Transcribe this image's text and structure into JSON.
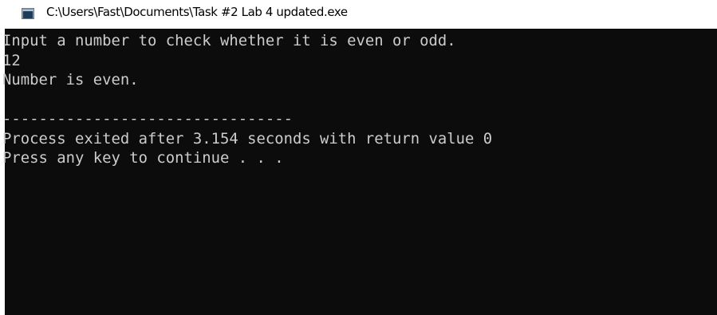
{
  "window": {
    "title": "C:\\Users\\Fast\\Documents\\Task #2 Lab 4 updated.exe",
    "icon": "console-window-icon"
  },
  "console": {
    "lines": [
      "Input a number to check whether it is even or odd.",
      "12",
      "Number is even.",
      "",
      "--------------------------------",
      "Process exited after 3.154 seconds with return value 0",
      "Press any key to continue . . ."
    ]
  }
}
